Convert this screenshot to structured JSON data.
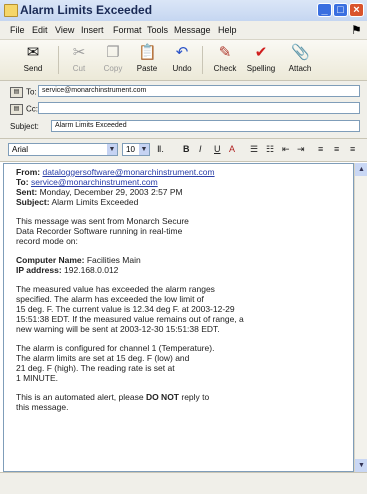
{
  "window": {
    "title": "Alarm Limits Exceeded"
  },
  "menu": [
    "File",
    "Edit",
    "View",
    "Insert",
    "Format",
    "Tools",
    "Message",
    "Help"
  ],
  "toolbar": {
    "send": "Send",
    "cut": "Cut",
    "copy": "Copy",
    "paste": "Paste",
    "undo": "Undo",
    "check": "Check",
    "spelling": "Spelling",
    "attach": "Attach"
  },
  "header": {
    "to_label": "To:",
    "to_value": "service@monarchinstrument.com",
    "cc_label": "Cc:",
    "cc_value": "",
    "subject_label": "Subject:",
    "subject_value": "Alarm Limits Exceeded"
  },
  "format": {
    "font": "Arial",
    "size": "10"
  },
  "message": {
    "from_label": "From:",
    "from_value": "dataloggersoftware@monarchinstrument.com",
    "to_label": "To:",
    "to_value": "service@monarchinstrument.com",
    "sent_label": "Sent:",
    "sent_value": "Monday, December 29, 2003 2:57 PM",
    "subject_label": "Subject:",
    "subject_value": "Alarm Limits Exceeded",
    "intro": [
      "This message was sent from Monarch Secure",
      "Data Recorder Software running in real-time",
      "record mode on:"
    ],
    "computer_label": "Computer Name:",
    "computer_value": "Facilities Main",
    "ip_label": "IP address:",
    "ip_value": "192.168.0.012",
    "para1": [
      "The measured value has exceeded the alarm ranges",
      "specified. The alarm has exceeded the low limit of",
      "15 deg. F. The current value is 12.34 deg F. at 2003-12-29",
      "15:51:38 EDT. If the measured value remains out of range, a",
      "new warning will be sent at 2003-12-30 15:51:38 EDT."
    ],
    "para2": [
      "The alarm is configured for channel 1 (Temperature).",
      "The alarm limits are set at 15 deg. F (low) and",
      "21 deg. F (high). The reading rate is set at",
      "1 MINUTE."
    ],
    "closing_a": "This is an automated alert, please ",
    "closing_b": "DO NOT",
    "closing_c": " reply to",
    "closing_d": "this message."
  }
}
